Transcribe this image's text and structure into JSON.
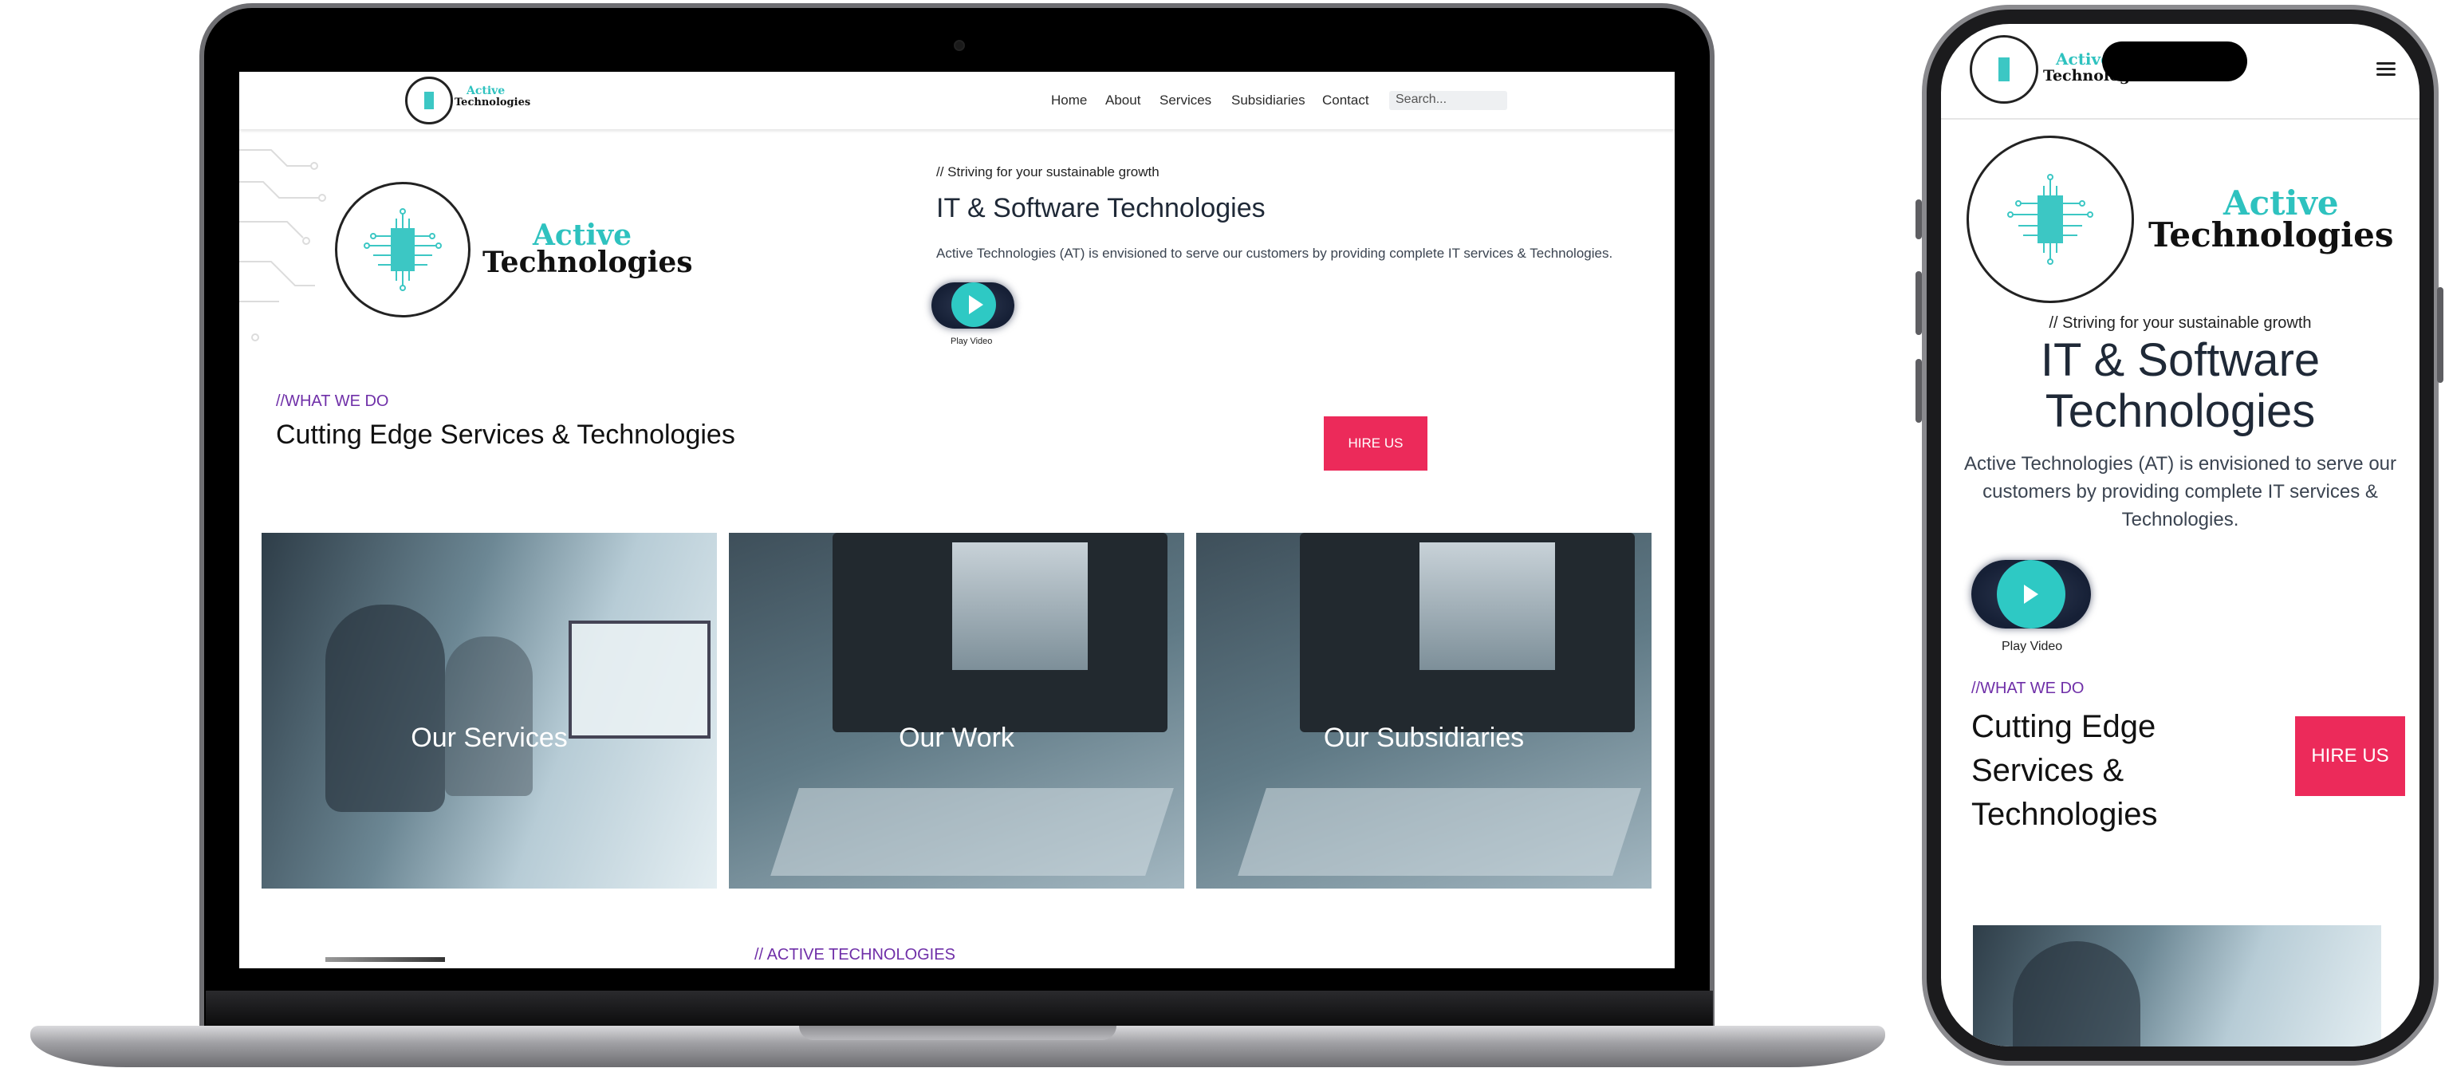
{
  "brand": {
    "line1": "Active",
    "line2": "Technologies"
  },
  "nav": {
    "links": [
      "Home",
      "About",
      "Services",
      "Subsidiaries",
      "Contact"
    ],
    "search_placeholder": "Search..."
  },
  "hero": {
    "tagline": "// Striving for your sustainable growth",
    "title": "IT & Software Technologies",
    "description": "Active Technologies (AT) is envisioned to serve our customers by providing complete IT services & Technologies.",
    "play_label": "Play Video"
  },
  "what_we_do": {
    "eyebrow": "//WHAT WE DO",
    "heading": "Cutting Edge Services & Technologies",
    "hire_label": "HIRE US"
  },
  "cards": [
    {
      "label": "Our Services",
      "image": "people-at-computer"
    },
    {
      "label": "Our Work",
      "image": "desk-with-monitor"
    },
    {
      "label": "Our Subsidiaries",
      "image": "desk-with-monitor"
    }
  ],
  "section_eyebrow": "// ACTIVE TECHNOLOGIES",
  "mobile": {
    "title_line1": "IT & Software",
    "title_line2": "Technologies",
    "heading_lines": [
      "Cutting Edge",
      "Services &",
      "Technologies"
    ],
    "menu_icon": "hamburger-icon"
  },
  "colors": {
    "accent": "#2ec9c4",
    "eyebrow": "#6f2fa8",
    "hire_button": "#ec2a5a",
    "play_bg": "#1c2740"
  }
}
